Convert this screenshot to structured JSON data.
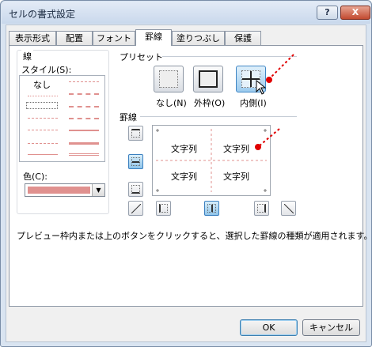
{
  "window": {
    "title": "セルの書式設定",
    "help_label": "?",
    "close_label": "X"
  },
  "tabs": [
    "表示形式",
    "配置",
    "フォント",
    "罫線",
    "塗りつぶし",
    "保護"
  ],
  "active_tab": "罫線",
  "line_section": {
    "label": "線",
    "style_label": "スタイル(S):",
    "none_label": "なし",
    "color_label": "色(C):",
    "color_value": "#e0918f"
  },
  "preset_section": {
    "label": "プリセット",
    "buttons": [
      "なし(N)",
      "外枠(O)",
      "内側(I)"
    ]
  },
  "border_section": {
    "label": "罫線",
    "cells": [
      "文字列",
      "文字列",
      "文字列",
      "文字列"
    ]
  },
  "hint": "プレビュー枠内または上のボタンをクリックすると、選択した罫線の種類が適用されます。",
  "buttons": {
    "ok": "OK",
    "cancel": "キャンセル"
  },
  "accent_colors": {
    "line_color": "#e0918f",
    "annotation": "#e00000"
  }
}
